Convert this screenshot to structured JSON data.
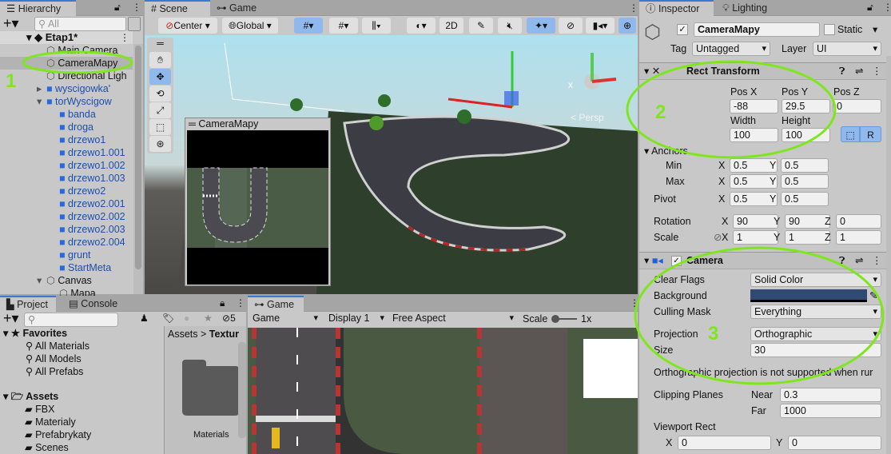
{
  "hierarchy": {
    "tab": "Hierarchy",
    "search_placeholder": "All",
    "scene": "Etap1*",
    "items": [
      {
        "label": "Main Camera",
        "depth": 1,
        "prefab": false
      },
      {
        "label": "CameraMapy",
        "depth": 1,
        "prefab": false,
        "selected": true
      },
      {
        "label": "Directional Ligh",
        "depth": 1,
        "prefab": false
      },
      {
        "label": "wyscigowka'",
        "depth": 1,
        "prefab": true
      },
      {
        "label": "torWyscigow",
        "depth": 1,
        "prefab": true
      },
      {
        "label": "banda",
        "depth": 2,
        "prefab": true
      },
      {
        "label": "droga",
        "depth": 2,
        "prefab": true
      },
      {
        "label": "drzewo1",
        "depth": 2,
        "prefab": true
      },
      {
        "label": "drzewo1.001",
        "depth": 2,
        "prefab": true
      },
      {
        "label": "drzewo1.002",
        "depth": 2,
        "prefab": true
      },
      {
        "label": "drzewo1.003",
        "depth": 2,
        "prefab": true
      },
      {
        "label": "drzewo2",
        "depth": 2,
        "prefab": true
      },
      {
        "label": "drzewo2.001",
        "depth": 2,
        "prefab": true
      },
      {
        "label": "drzewo2.002",
        "depth": 2,
        "prefab": true
      },
      {
        "label": "drzewo2.003",
        "depth": 2,
        "prefab": true
      },
      {
        "label": "drzewo2.004",
        "depth": 2,
        "prefab": true
      },
      {
        "label": "grunt",
        "depth": 2,
        "prefab": true
      },
      {
        "label": "StartMeta",
        "depth": 2,
        "prefab": true
      },
      {
        "label": "Canvas",
        "depth": 1,
        "prefab": false
      },
      {
        "label": "Mapa",
        "depth": 2,
        "prefab": false
      }
    ]
  },
  "scene": {
    "tabs": [
      "Scene",
      "Game"
    ],
    "pivot": "Center",
    "space": "Global",
    "btn_2d": "2D",
    "persp": "< Persp",
    "preview_title": "CameraMapy"
  },
  "project": {
    "tabs": [
      "Project",
      "Console"
    ],
    "hidden_count": "5",
    "favorites": {
      "label": "Favorites",
      "items": [
        "All Materials",
        "All Models",
        "All Prefabs"
      ]
    },
    "assets": {
      "label": "Assets",
      "items": [
        "FBX",
        "Materialy",
        "Prefabrykaty",
        "Scenes"
      ]
    },
    "breadcrumb": [
      "Assets",
      "Textur"
    ],
    "folder": "Materials"
  },
  "game": {
    "tab": "Game",
    "mode": "Game",
    "display": "Display 1",
    "aspect": "Free Aspect",
    "scale_label": "Scale",
    "scale": "1x"
  },
  "inspector": {
    "tabs": [
      "Inspector",
      "Lighting"
    ],
    "name": "CameraMapy",
    "active": true,
    "static_label": "Static",
    "tag_label": "Tag",
    "tag": "Untagged",
    "layer_label": "Layer",
    "layer": "UI",
    "rect": {
      "title": "Rect Transform",
      "posx_label": "Pos X",
      "posy_label": "Pos Y",
      "posz_label": "Pos Z",
      "posx": "-88",
      "posy": "29.5",
      "posz": "0",
      "width_label": "Width",
      "height_label": "Height",
      "width": "100",
      "height": "100",
      "r_btn": "R",
      "anchors": "Anchors",
      "min": "Min",
      "max": "Max",
      "pivot": "Pivot",
      "min_x": "0.5",
      "min_y": "0.5",
      "max_x": "0.5",
      "max_y": "0.5",
      "pivot_x": "0.5",
      "pivot_y": "0.5",
      "rotation": "Rotation",
      "rot_x": "90",
      "rot_y": "90",
      "rot_z": "0",
      "scale": "Scale",
      "scale_x": "1",
      "scale_y": "1",
      "scale_z": "1",
      "x": "X",
      "y": "Y",
      "z": "Z"
    },
    "camera": {
      "title": "Camera",
      "clear_flags_label": "Clear Flags",
      "clear_flags": "Solid Color",
      "background_label": "Background",
      "background_color": "#2f4b73",
      "culling_label": "Culling Mask",
      "culling": "Everything",
      "projection_label": "Projection",
      "projection": "Orthographic",
      "size_label": "Size",
      "size": "30",
      "warning": "Orthographic projection is not supported when rur",
      "clipping_label": "Clipping Planes",
      "near_label": "Near",
      "near": "0.3",
      "far_label": "Far",
      "far": "1000",
      "viewport_label": "Viewport Rect",
      "vp_x": "0",
      "vp_y": "0"
    }
  },
  "annotations": [
    "1",
    "2",
    "3"
  ],
  "colors": {
    "accent": "#3a79d0",
    "annotation": "#7fe61e",
    "prefab": "#1e4fa8"
  }
}
